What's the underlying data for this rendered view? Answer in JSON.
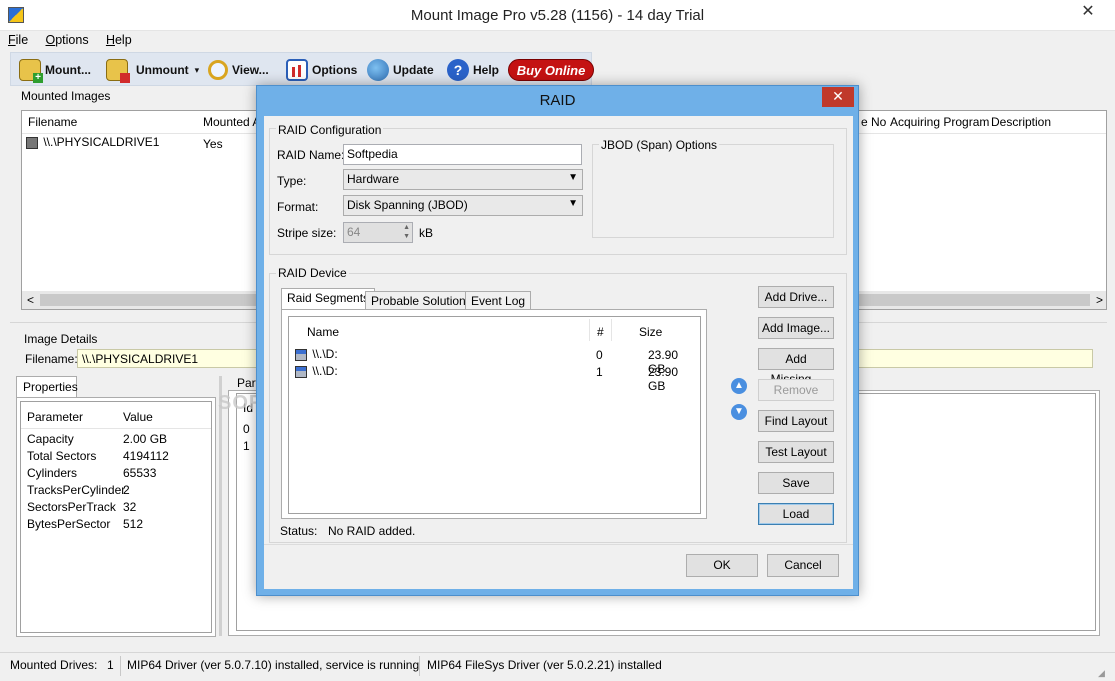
{
  "window": {
    "title": "Mount Image Pro v5.28 (1156) - 14 day Trial",
    "close_icon": "close-icon"
  },
  "menu": [
    {
      "key": "F",
      "rest": "ile"
    },
    {
      "key": "O",
      "rest": "ptions"
    },
    {
      "key": "H",
      "rest": "elp"
    }
  ],
  "toolbar": {
    "mount": "Mount...",
    "unmount": "Unmount",
    "unmount_caret": "▾",
    "view": "View...",
    "options": "Options",
    "update": "Update",
    "help": "Help",
    "buy": "Buy Online"
  },
  "mounted": {
    "group_label": "Mounted Images",
    "columns": [
      "Filename",
      "Mounted A",
      "e No",
      "Acquiring Program",
      "Description"
    ],
    "row": {
      "filename": "\\\\.\\PHYSICALDRIVE1",
      "mounted": "Yes"
    },
    "scroll_left": "<",
    "scroll_right": ">"
  },
  "image_details": {
    "group_label": "Image Details",
    "filename_label": "Filename:",
    "filename_value": "\\\\.\\PHYSICALDRIVE1",
    "properties_tab": "Properties",
    "columns": [
      "Parameter",
      "Value"
    ],
    "rows": [
      [
        "Capacity",
        "2.00 GB"
      ],
      [
        "Total Sectors",
        "4194112"
      ],
      [
        "Cylinders",
        "65533"
      ],
      [
        "TracksPerCylinder",
        "2"
      ],
      [
        "SectorsPerTrack",
        "32"
      ],
      [
        "BytesPerSector",
        "512"
      ]
    ],
    "part_tab": "Part",
    "part_col": "Id",
    "part_rows": [
      "0",
      "1"
    ],
    "watermark": "SOFTPEDIA"
  },
  "raid": {
    "title": "RAID",
    "config_label": "RAID Configuration",
    "name_label": "RAID Name:",
    "name_value": "Softpedia",
    "type_label": "Type:",
    "type_value": "Hardware",
    "format_label": "Format:",
    "format_value": "Disk Spanning (JBOD)",
    "stripe_label": "Stripe size:",
    "stripe_value": "64",
    "stripe_unit": "kB",
    "jbod_label": "JBOD (Span) Options",
    "device_label": "RAID Device",
    "tabs": [
      "Raid Segments",
      "Probable Solutions",
      "Event Log"
    ],
    "columns": [
      "Name",
      "#",
      "Size"
    ],
    "segments": [
      {
        "name": "\\\\.\\D:",
        "num": "0",
        "size": "23.90 GB"
      },
      {
        "name": "\\\\.\\D:",
        "num": "1",
        "size": "23.90 GB"
      }
    ],
    "buttons": {
      "add_drive": "Add Drive...",
      "add_image": "Add Image...",
      "add_missing": "Add Missing...",
      "remove": "Remove",
      "find_layout": "Find Layout",
      "test_layout": "Test Layout",
      "save": "Save",
      "load": "Load",
      "ok": "OK",
      "cancel": "Cancel"
    },
    "status_label": "Status:",
    "status_value": "No RAID added."
  },
  "statusbar": {
    "drives_label": "Mounted Drives:",
    "drives_count": "1",
    "driver": "MIP64 Driver (ver 5.0.7.10) installed, service is running",
    "fs_driver": "MIP64 FileSys Driver (ver 5.0.2.21) installed"
  }
}
